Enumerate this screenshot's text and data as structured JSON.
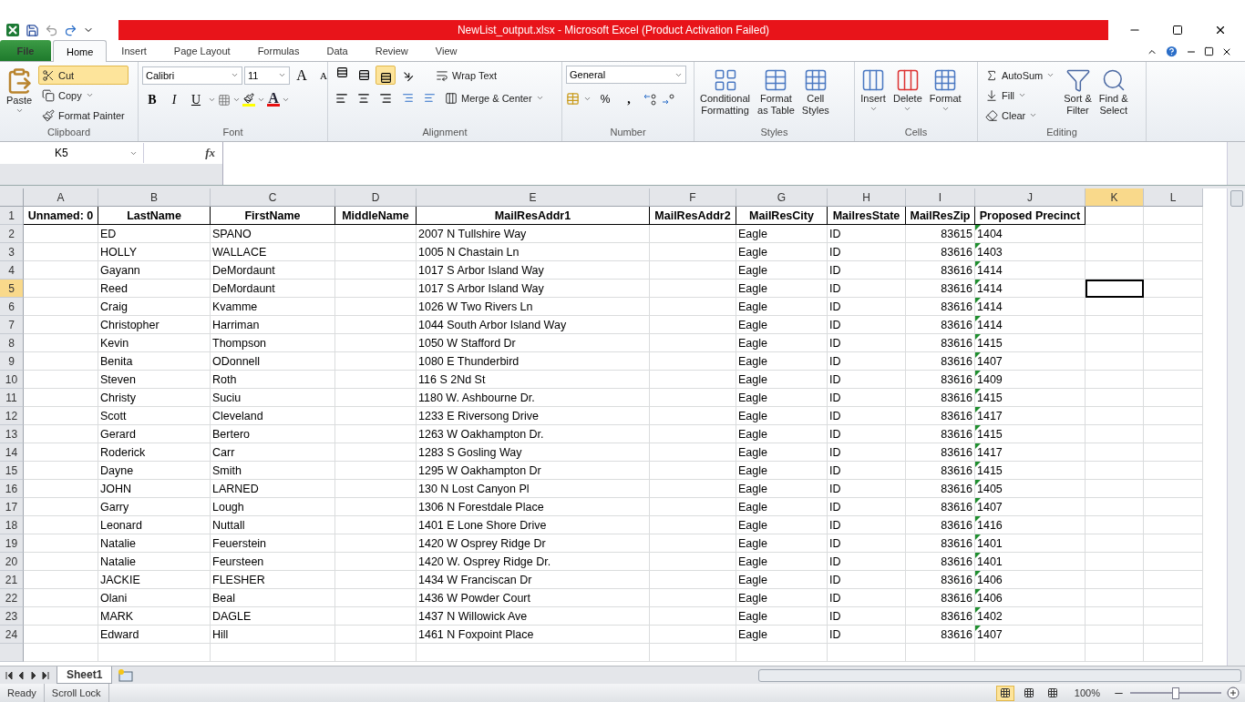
{
  "title_bar": {
    "title": "NewList_output.xlsx  -  Microsoft Excel (Product Activation Failed)"
  },
  "ribbon_tabs": [
    {
      "label": "File",
      "kind": "file",
      "selected": false
    },
    {
      "label": "Home",
      "kind": "tab",
      "selected": true
    },
    {
      "label": "Insert",
      "kind": "tab",
      "selected": false
    },
    {
      "label": "Page Layout",
      "kind": "tab",
      "selected": false
    },
    {
      "label": "Formulas",
      "kind": "tab",
      "selected": false
    },
    {
      "label": "Data",
      "kind": "tab",
      "selected": false
    },
    {
      "label": "Review",
      "kind": "tab",
      "selected": false
    },
    {
      "label": "View",
      "kind": "tab",
      "selected": false
    }
  ],
  "clipboard": {
    "name": "Clipboard",
    "paste": "Paste",
    "items": [
      {
        "label": "Cut",
        "active": true,
        "dropdown": false
      },
      {
        "label": "Copy",
        "active": false,
        "dropdown": true
      },
      {
        "label": "Format Painter",
        "active": false,
        "dropdown": false
      }
    ]
  },
  "font": {
    "name": "Font",
    "font_name": "Calibri",
    "font_size": "11",
    "grow_label": "A",
    "shrink_label": "A",
    "style_buttons": [
      {
        "label": "B",
        "kind": "bold"
      },
      {
        "label": "I",
        "kind": "italic"
      },
      {
        "label": "U",
        "kind": "underline"
      }
    ],
    "font_color_label": "A"
  },
  "alignment": {
    "name": "Alignment",
    "vertical_align": [
      {
        "selected": false
      },
      {
        "selected": false
      },
      {
        "selected": true
      }
    ],
    "horizontal_align": [
      {
        "selected": false
      },
      {
        "selected": false
      },
      {
        "selected": false
      }
    ],
    "wrap_text": "Wrap Text",
    "merge": "Merge & Center"
  },
  "number": {
    "name": "Number",
    "format": "General",
    "percent": "%",
    "comma": ","
  },
  "styles": {
    "name": "Styles",
    "buttons": [
      {
        "lines": [
          "Conditional",
          "Formatting"
        ]
      },
      {
        "lines": [
          "Format",
          "as Table"
        ]
      },
      {
        "lines": [
          "Cell",
          "Styles"
        ]
      }
    ]
  },
  "cells": {
    "name": "Cells",
    "buttons": [
      {
        "label": "Insert"
      },
      {
        "label": "Delete"
      },
      {
        "label": "Format"
      }
    ]
  },
  "editing": {
    "name": "Editing",
    "items": [
      {
        "label": "AutoSum"
      },
      {
        "label": "Fill"
      },
      {
        "label": "Clear"
      }
    ],
    "buttons": [
      {
        "lines": [
          "Sort &",
          "Filter"
        ]
      },
      {
        "lines": [
          "Find &",
          "Select"
        ]
      }
    ]
  },
  "formula_bar": {
    "name_box": "K5",
    "function_label": "fx"
  },
  "columns": [
    {
      "letter": "A",
      "selected": false
    },
    {
      "letter": "B",
      "selected": false
    },
    {
      "letter": "C",
      "selected": false
    },
    {
      "letter": "D",
      "selected": false
    },
    {
      "letter": "E",
      "selected": false
    },
    {
      "letter": "F",
      "selected": false
    },
    {
      "letter": "G",
      "selected": false
    },
    {
      "letter": "H",
      "selected": false
    },
    {
      "letter": "I",
      "selected": false
    },
    {
      "letter": "J",
      "selected": false
    },
    {
      "letter": "K",
      "selected": true
    },
    {
      "letter": "L",
      "selected": false
    }
  ],
  "header_row": {
    "number": "1",
    "cells": [
      "Unnamed: 0",
      "LastName",
      "FirstName",
      "MiddleName",
      "MailResAddr1",
      "MailResAddr2",
      "MailResCity",
      "MailresState",
      "MailResZip",
      "Proposed Precinct"
    ]
  },
  "rows": [
    {
      "number": "2",
      "last_name": "ED",
      "first_name": "SPANO",
      "address": "2007 N Tullshire Way",
      "city": "Eagle",
      "state": "ID",
      "zip": "83615",
      "precinct": "1404",
      "selected": false
    },
    {
      "number": "3",
      "last_name": "HOLLY",
      "first_name": "WALLACE",
      "address": "1005 N Chastain Ln",
      "city": "Eagle",
      "state": "ID",
      "zip": "83616",
      "precinct": "1403",
      "selected": false
    },
    {
      "number": "4",
      "last_name": "Gayann",
      "first_name": "DeMordaunt",
      "address": "1017 S Arbor Island Way",
      "city": "Eagle",
      "state": "ID",
      "zip": "83616",
      "precinct": "1414",
      "selected": false
    },
    {
      "number": "5",
      "last_name": "Reed",
      "first_name": "DeMordaunt",
      "address": "1017 S Arbor Island Way",
      "city": "Eagle",
      "state": "ID",
      "zip": "83616",
      "precinct": "1414",
      "selected": true
    },
    {
      "number": "6",
      "last_name": "Craig",
      "first_name": "Kvamme",
      "address": "1026 W Two Rivers Ln",
      "city": "Eagle",
      "state": "ID",
      "zip": "83616",
      "precinct": "1414",
      "selected": false
    },
    {
      "number": "7",
      "last_name": "Christopher",
      "first_name": "Harriman",
      "address": "1044 South Arbor Island Way",
      "city": "Eagle",
      "state": "ID",
      "zip": "83616",
      "precinct": "1414",
      "selected": false
    },
    {
      "number": "8",
      "last_name": "Kevin",
      "first_name": "Thompson",
      "address": "1050 W Stafford Dr",
      "city": "Eagle",
      "state": "ID",
      "zip": "83616",
      "precinct": "1415",
      "selected": false
    },
    {
      "number": "9",
      "last_name": "Benita",
      "first_name": "ODonnell",
      "address": "1080 E Thunderbird",
      "city": "Eagle",
      "state": "ID",
      "zip": "83616",
      "precinct": "1407",
      "selected": false
    },
    {
      "number": "10",
      "last_name": "Steven",
      "first_name": "Roth",
      "address": "116 S 2Nd St",
      "city": "Eagle",
      "state": "ID",
      "zip": "83616",
      "precinct": "1409",
      "selected": false
    },
    {
      "number": "11",
      "last_name": "Christy",
      "first_name": "Suciu",
      "address": "1180 W. Ashbourne Dr.",
      "city": "Eagle",
      "state": "ID",
      "zip": "83616",
      "precinct": "1415",
      "selected": false
    },
    {
      "number": "12",
      "last_name": "Scott",
      "first_name": "Cleveland",
      "address": "1233 E Riversong Drive",
      "city": "Eagle",
      "state": "ID",
      "zip": "83616",
      "precinct": "1417",
      "selected": false
    },
    {
      "number": "13",
      "last_name": "Gerard",
      "first_name": "Bertero",
      "address": "1263 W Oakhampton Dr.",
      "city": "Eagle",
      "state": "ID",
      "zip": "83616",
      "precinct": "1415",
      "selected": false
    },
    {
      "number": "14",
      "last_name": "Roderick",
      "first_name": "Carr",
      "address": "1283 S Gosling Way",
      "city": "Eagle",
      "state": "ID",
      "zip": "83616",
      "precinct": "1417",
      "selected": false
    },
    {
      "number": "15",
      "last_name": "Dayne",
      "first_name": "Smith",
      "address": "1295 W Oakhampton Dr",
      "city": "Eagle",
      "state": "ID",
      "zip": "83616",
      "precinct": "1415",
      "selected": false
    },
    {
      "number": "16",
      "last_name": "JOHN",
      "first_name": "LARNED",
      "address": "130 N Lost Canyon Pl",
      "city": "Eagle",
      "state": "ID",
      "zip": "83616",
      "precinct": "1405",
      "selected": false
    },
    {
      "number": "17",
      "last_name": "Garry",
      "first_name": "Lough",
      "address": "1306 N Forestdale Place",
      "city": "Eagle",
      "state": "ID",
      "zip": "83616",
      "precinct": "1407",
      "selected": false
    },
    {
      "number": "18",
      "last_name": "Leonard",
      "first_name": "Nuttall",
      "address": "1401 E Lone Shore Drive",
      "city": "Eagle",
      "state": "ID",
      "zip": "83616",
      "precinct": "1416",
      "selected": false
    },
    {
      "number": "19",
      "last_name": "Natalie",
      "first_name": "Feuerstein",
      "address": "1420 W Osprey Ridge Dr",
      "city": "Eagle",
      "state": "ID",
      "zip": "83616",
      "precinct": "1401",
      "selected": false
    },
    {
      "number": "20",
      "last_name": "Natalie",
      "first_name": "Feursteen",
      "address": "1420 W. Osprey Ridge Dr.",
      "city": "Eagle",
      "state": "ID",
      "zip": "83616",
      "precinct": "1401",
      "selected": false
    },
    {
      "number": "21",
      "last_name": "JACKIE",
      "first_name": "FLESHER",
      "address": "1434 W Franciscan Dr",
      "city": "Eagle",
      "state": "ID",
      "zip": "83616",
      "precinct": "1406",
      "selected": false
    },
    {
      "number": "22",
      "last_name": "Olani",
      "first_name": "Beal",
      "address": "1436 W Powder Court",
      "city": "Eagle",
      "state": "ID",
      "zip": "83616",
      "precinct": "1406",
      "selected": false
    },
    {
      "number": "23",
      "last_name": "MARK",
      "first_name": "DAGLE",
      "address": "1437 N Willowick Ave",
      "city": "Eagle",
      "state": "ID",
      "zip": "83616",
      "precinct": "1402",
      "selected": false
    },
    {
      "number": "24",
      "last_name": "Edward",
      "first_name": "Hill",
      "address": "1461 N Foxpoint Place",
      "city": "Eagle",
      "state": "ID",
      "zip": "83616",
      "precinct": "1407",
      "selected": false
    }
  ],
  "sheet_tabs": [
    {
      "label": "Sheet1",
      "selected": true
    }
  ],
  "status_bar": {
    "items": [
      "Ready",
      "Scroll Lock"
    ],
    "views": [
      {
        "selected": true
      },
      {
        "selected": false
      },
      {
        "selected": false
      }
    ],
    "zoom": "100%",
    "zoom_slider": {
      "level": 0.5
    }
  }
}
